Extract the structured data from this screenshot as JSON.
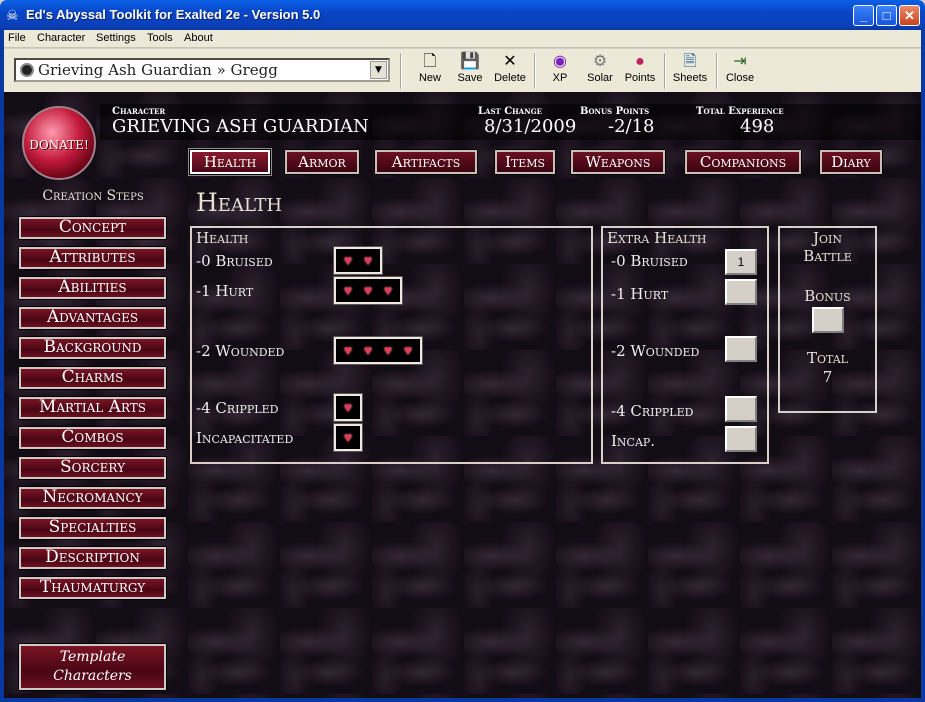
{
  "window": {
    "title": "Ed's Abyssal Toolkit for Exalted 2e - Version 5.0",
    "minimize": "_",
    "maximize": "□",
    "close": "✕"
  },
  "menu": [
    "File",
    "Character",
    "Settings",
    "Tools",
    "About"
  ],
  "character_select": {
    "value": "Grieving Ash Guardian » Gregg"
  },
  "toolbar": [
    {
      "label": "New",
      "icon": "new-document-icon",
      "glyph": "🗋"
    },
    {
      "label": "Save",
      "icon": "floppy-disk-icon",
      "glyph": "💾"
    },
    {
      "label": "Delete",
      "icon": "delete-x-icon",
      "glyph": "✕"
    },
    {
      "label": "XP",
      "icon": "xp-icon",
      "glyph": "◉"
    },
    {
      "label": "Solar",
      "icon": "solar-gear-icon",
      "glyph": "⚙"
    },
    {
      "label": "Points",
      "icon": "points-icon",
      "glyph": "●"
    },
    {
      "label": "Sheets",
      "icon": "sheets-icon",
      "glyph": "🗎"
    },
    {
      "label": "Close",
      "icon": "close-door-icon",
      "glyph": "⇥"
    }
  ],
  "donate": "DONATE!",
  "header": {
    "character_label": "Character",
    "character_name": "GRIEVING ASH GUARDIAN",
    "last_change_label": "Last Change",
    "last_change": "8/31/2009",
    "bonus_points_label": "Bonus Points",
    "bonus_points": "-2/18",
    "total_xp_label": "Total Experience",
    "total_xp": "498"
  },
  "tabs": [
    "Health",
    "Armor",
    "Artifacts",
    "Items",
    "Weapons",
    "Companions",
    "Diary"
  ],
  "active_tab": "Health",
  "creation_steps_title": "Creation Steps",
  "steps": [
    "Concept",
    "Attributes",
    "Abilities",
    "Advantages",
    "Background",
    "Charms",
    "Martial Arts",
    "Combos",
    "Sorcery",
    "Necromancy",
    "Specialties",
    "Description",
    "Thaumaturgy"
  ],
  "template_button": [
    "Template",
    "Characters"
  ],
  "page_title": "Health",
  "health_panel": {
    "title": "Health",
    "rows": [
      {
        "label": "-0 Bruised",
        "hearts": 2
      },
      {
        "label": "-1 Hurt",
        "hearts": 3
      },
      {
        "label": "-2 Wounded",
        "hearts": 4
      },
      {
        "label": "-4 Crippled",
        "hearts": 1
      },
      {
        "label": "Incapacitated",
        "hearts": 1
      }
    ],
    "heart_glyph": "♥",
    "heart_color": "#e03a5a"
  },
  "extra_health_panel": {
    "title": "Extra Health",
    "rows": [
      {
        "label": "-0 Bruised",
        "value": "1"
      },
      {
        "label": "-1 Hurt",
        "value": ""
      },
      {
        "label": "-2 Wounded",
        "value": ""
      },
      {
        "label": "-4 Crippled",
        "value": ""
      },
      {
        "label": "Incap.",
        "value": ""
      }
    ]
  },
  "join_battle": {
    "title_line1": "Join",
    "title_line2": "Battle",
    "bonus_label": "Bonus",
    "bonus_value": "",
    "total_label": "Total",
    "total_value": "7"
  }
}
